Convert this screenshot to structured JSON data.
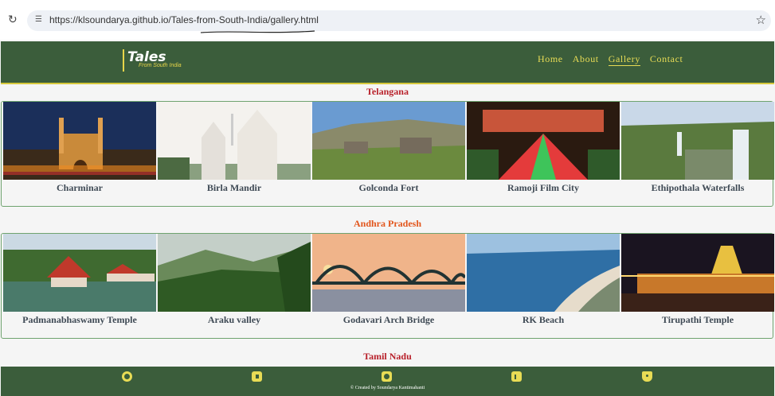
{
  "browser": {
    "url": "https://klsoundarya.github.io/Tales-from-South-India/gallery.html",
    "reload_icon": "reload-icon",
    "site_info_icon": "site-info-icon",
    "bookmark_icon": "star-icon"
  },
  "nav": {
    "logo_main": "Tales",
    "logo_sub": "From South India",
    "items": [
      "Home",
      "About",
      "Gallery",
      "Contact"
    ],
    "active": "Gallery"
  },
  "sections": [
    {
      "title": "Telangana",
      "title_color": "#b8202a",
      "places": [
        "Charminar",
        "Birla Mandir",
        "Golconda Fort",
        "Ramoji Film City",
        "Ethipothala Waterfalls"
      ]
    },
    {
      "title": "Andhra Pradesh",
      "title_color": "#e2551b",
      "places": [
        "Padmanabhaswamy Temple",
        "Araku valley",
        "Godavari Arch Bridge",
        "RK Beach",
        "Tirupathi Temple"
      ]
    },
    {
      "title": "Tamil Nadu",
      "title_color": "#b8202a",
      "places": []
    }
  ],
  "footer": {
    "icons": [
      "facebook-icon",
      "youtube-icon",
      "instagram-icon",
      "linkedin-icon",
      "map-icon"
    ],
    "copyright": "© Created by Soundarya Kantimahanti"
  },
  "colors": {
    "nav_bg": "#3b5d3b",
    "nav_text": "#e8dc55",
    "card_border": "#6fa36f"
  }
}
